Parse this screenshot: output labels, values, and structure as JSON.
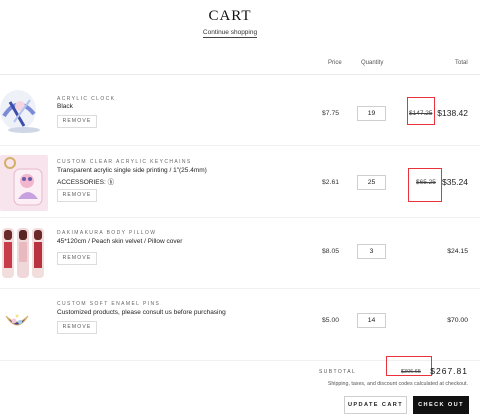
{
  "page": {
    "title": "CART",
    "continue_link": "Continue shopping"
  },
  "table_headers": {
    "price": "Price",
    "quantity": "Quantity",
    "total": "Total"
  },
  "items": [
    {
      "vendor": "ACRYLIC CLOCK",
      "name": "Black",
      "line2": "",
      "remove": "REMOVE",
      "price": "$7.75",
      "quantity": "19",
      "old_total": "$147.25",
      "total": "$138.42"
    },
    {
      "vendor": "CUSTOM CLEAR ACRYLIC KEYCHAINS",
      "name": "Transparent acrylic single side printing / 1\"(25.4mm)",
      "line2": "ACCESSORIES: ⓑ",
      "remove": "REMOVE",
      "price": "$2.61",
      "quantity": "25",
      "old_total": "$65.25",
      "total": "$35.24"
    },
    {
      "vendor": "DAKIMAKURA BODY PILLOW",
      "name": "45*120cm / Peach skin velvet / Pillow cover",
      "line2": "",
      "remove": "REMOVE",
      "price": "$8.05",
      "quantity": "3",
      "old_total": "",
      "total": "$24.15"
    },
    {
      "vendor": "CUSTOM SOFT ENAMEL PINS",
      "name": "Customized products, please consult us before purchasing",
      "line2": "",
      "remove": "REMOVE",
      "price": "$5.00",
      "quantity": "14",
      "old_total": "",
      "total": "$70.00"
    }
  ],
  "summary": {
    "subtotal_label": "SUBTOTAL",
    "old_subtotal": "$306.65",
    "subtotal": "$267.81",
    "shipping_note": "Shipping, taxes, and discount codes calculated at checkout."
  },
  "buttons": {
    "update": "UPDATE CART",
    "checkout": "CHECK OUT"
  },
  "colors": {
    "highlight_box": "#e8323c",
    "checkout_bg": "#111111"
  }
}
